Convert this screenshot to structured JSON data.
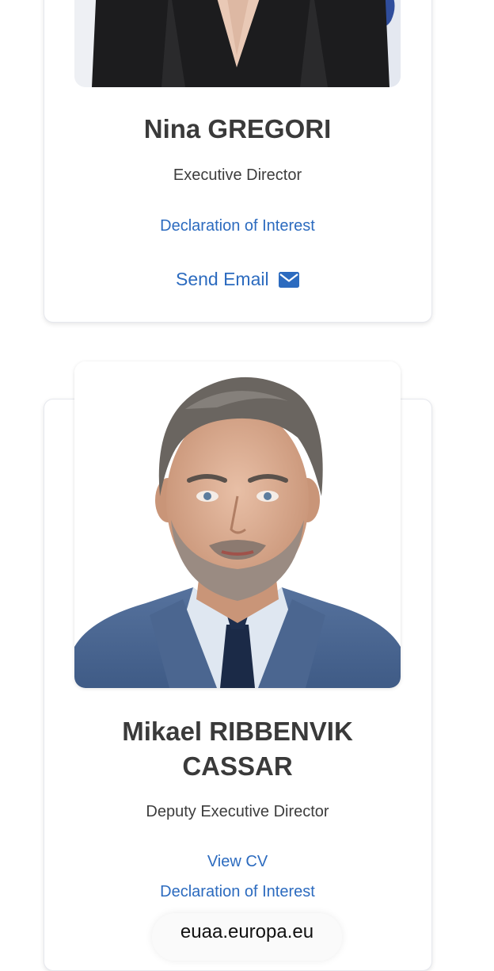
{
  "people": [
    {
      "name": "Nina GREGORI",
      "role": "Executive Director",
      "links": {
        "declaration": "Declaration of Interest",
        "send_email": "Send Email"
      }
    },
    {
      "name_line1": "Mikael RIBBENVIK",
      "name_line2": "CASSAR",
      "role": "Deputy Executive Director",
      "links": {
        "cv": "View CV",
        "declaration": "Declaration of Interest"
      }
    }
  ],
  "browser": {
    "url": "euaa.europa.eu"
  },
  "colors": {
    "link": "#2c6bbf",
    "text": "#3a3a3a",
    "card_border": "#e6e8ee"
  },
  "icons": {
    "email": "envelope-icon"
  }
}
